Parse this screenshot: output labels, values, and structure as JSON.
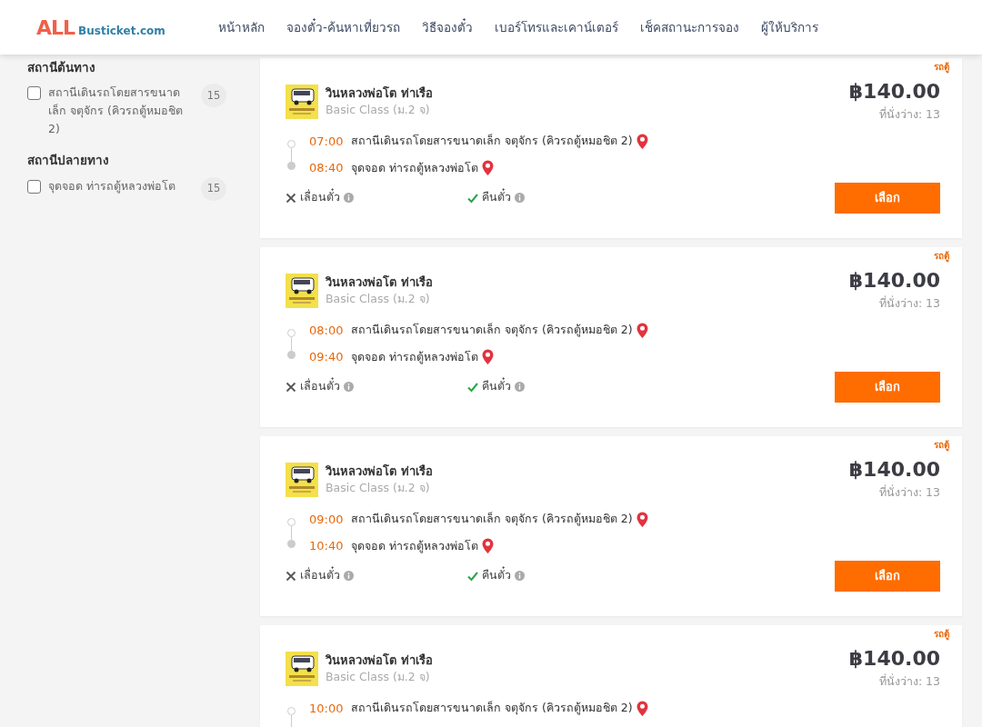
{
  "header": {
    "logo": {
      "big": "ALL",
      "small": "Busticket.com"
    },
    "nav": [
      {
        "label": "หน้าหลัก"
      },
      {
        "label": "จองตั๋ว-ค้นหาเที่ยวรถ"
      },
      {
        "label": "วิธีจองตั๋ว"
      },
      {
        "label": "เบอร์โทรและเคาน์เตอร์"
      },
      {
        "label": "เช็คสถานะการจอง"
      },
      {
        "label": "ผู้ให้บริการ"
      }
    ]
  },
  "sidebar": {
    "groups": [
      {
        "title": "สถานีต้นทาง",
        "options": [
          {
            "label": "สถานีเดินรถโดยสารขนาดเล็ก จตุจักร (คิวรถตู้หมอชิต 2)",
            "count": "15",
            "checked": false
          }
        ]
      },
      {
        "title": "สถานีปลายทาง",
        "options": [
          {
            "label": "จุดจอด ท่ารถตู้หลวงพ่อโต",
            "count": "15",
            "checked": false
          }
        ]
      }
    ]
  },
  "trips": [
    {
      "tag": "รถตู้",
      "operator": "วินหลวงพ่อโต ท่าเรือ",
      "class": "Basic Class (ม.2 จ)",
      "price": "฿140.00",
      "seats": "ที่นั่งว่าง: 13",
      "stops": [
        {
          "time": "07:00",
          "place": "สถานีเดินรถโดยสารขนาดเล็ก จตุจักร (คิวรถตู้หมอชิต 2)"
        },
        {
          "time": "08:40",
          "place": "จุดจอด ท่ารถตู้หลวงพ่อโต"
        }
      ],
      "postpone": {
        "label": "เลื่อนตั๋ว",
        "allowed": false
      },
      "refund": {
        "label": "คืนตั๋ว",
        "allowed": true
      },
      "button": "เลือก"
    },
    {
      "tag": "รถตู้",
      "operator": "วินหลวงพ่อโต ท่าเรือ",
      "class": "Basic Class (ม.2 จ)",
      "price": "฿140.00",
      "seats": "ที่นั่งว่าง: 13",
      "stops": [
        {
          "time": "08:00",
          "place": "สถานีเดินรถโดยสารขนาดเล็ก จตุจักร (คิวรถตู้หมอชิต 2)"
        },
        {
          "time": "09:40",
          "place": "จุดจอด ท่ารถตู้หลวงพ่อโต"
        }
      ],
      "postpone": {
        "label": "เลื่อนตั๋ว",
        "allowed": false
      },
      "refund": {
        "label": "คืนตั๋ว",
        "allowed": true
      },
      "button": "เลือก"
    },
    {
      "tag": "รถตู้",
      "operator": "วินหลวงพ่อโต ท่าเรือ",
      "class": "Basic Class (ม.2 จ)",
      "price": "฿140.00",
      "seats": "ที่นั่งว่าง: 13",
      "stops": [
        {
          "time": "09:00",
          "place": "สถานีเดินรถโดยสารขนาดเล็ก จตุจักร (คิวรถตู้หมอชิต 2)"
        },
        {
          "time": "10:40",
          "place": "จุดจอด ท่ารถตู้หลวงพ่อโต"
        }
      ],
      "postpone": {
        "label": "เลื่อนตั๋ว",
        "allowed": false
      },
      "refund": {
        "label": "คืนตั๋ว",
        "allowed": true
      },
      "button": "เลือก"
    },
    {
      "tag": "รถตู้",
      "operator": "วินหลวงพ่อโต ท่าเรือ",
      "class": "Basic Class (ม.2 จ)",
      "price": "฿140.00",
      "seats": "ที่นั่งว่าง: 13",
      "stops": [
        {
          "time": "10:00",
          "place": "สถานีเดินรถโดยสารขนาดเล็ก จตุจักร (คิวรถตู้หมอชิต 2)"
        }
      ]
    }
  ]
}
